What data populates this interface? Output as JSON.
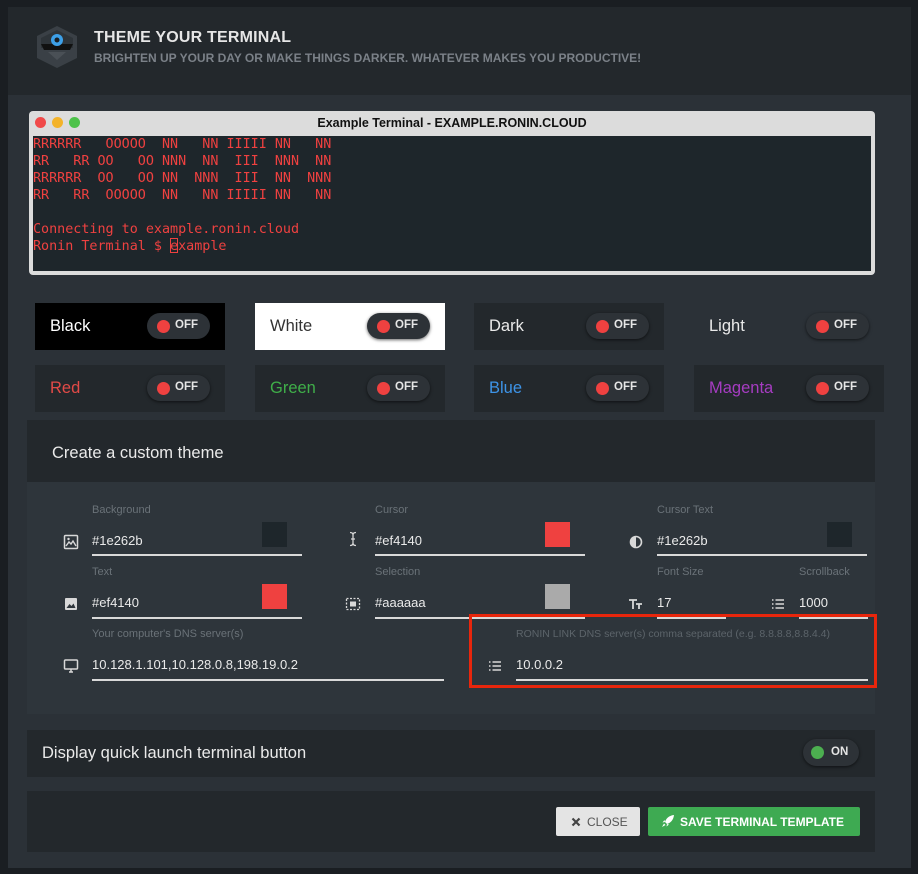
{
  "header": {
    "title": "THEME YOUR TERMINAL",
    "subtitle": "BRIGHTEN UP YOUR DAY OR MAKE THINGS DARKER. WHATEVER MAKES YOU PRODUCTIVE!"
  },
  "terminal": {
    "title": "Example Terminal - EXAMPLE.RONIN.CLOUD",
    "banner": [
      "RRRRRR   OOOOO  NN   NN IIIII NN   NN",
      "RR   RR OO   OO NNN  NN  III  NNN  NN",
      "RRRRRR  OO   OO NN  NNN  III  NN  NNN",
      "RR   RR  OOOOO  NN   NN IIIII NN   NN"
    ],
    "connecting": "Connecting to example.ronin.cloud",
    "prompt": "Ronin Terminal $ ",
    "command": "example",
    "background": "#1e262b",
    "text_color": "#ef4140"
  },
  "themes": [
    {
      "label": "Black",
      "state": "OFF"
    },
    {
      "label": "White",
      "state": "OFF"
    },
    {
      "label": "Dark",
      "state": "OFF"
    },
    {
      "label": "Light",
      "state": "OFF"
    },
    {
      "label": "Red",
      "state": "OFF"
    },
    {
      "label": "Green",
      "state": "OFF"
    },
    {
      "label": "Blue",
      "state": "OFF"
    },
    {
      "label": "Magenta",
      "state": "OFF"
    }
  ],
  "custom": {
    "title": "Create a custom theme",
    "fields": {
      "background": {
        "label": "Background",
        "value": "#1e262b"
      },
      "cursor": {
        "label": "Cursor",
        "value": "#ef4140"
      },
      "cursor_text": {
        "label": "Cursor Text",
        "value": "#1e262b"
      },
      "text": {
        "label": "Text",
        "value": "#ef4140"
      },
      "selection": {
        "label": "Selection",
        "value": "#aaaaaa"
      },
      "font_size": {
        "label": "Font Size",
        "value": "17"
      },
      "scrollback": {
        "label": "Scrollback",
        "value": "1000"
      },
      "dns": {
        "label": "Your computer's DNS server(s)",
        "value": "10.128.1.101,10.128.0.8,198.19.0.2"
      },
      "ronin_dns": {
        "label": "RONIN LINK DNS server(s) comma separated (e.g. 8.8.8.8,8.8.4.4)",
        "value": "10.0.0.2"
      }
    }
  },
  "quick_launch": {
    "label": "Display quick launch terminal button",
    "state": "ON"
  },
  "footer": {
    "close_label": "CLOSE",
    "save_label": "SAVE TERMINAL TEMPLATE"
  },
  "colors": {
    "accent_green": "#3eaa52",
    "toggle_off": "#ef4140",
    "toggle_on": "#4caf50",
    "highlight": "#e8260c"
  }
}
